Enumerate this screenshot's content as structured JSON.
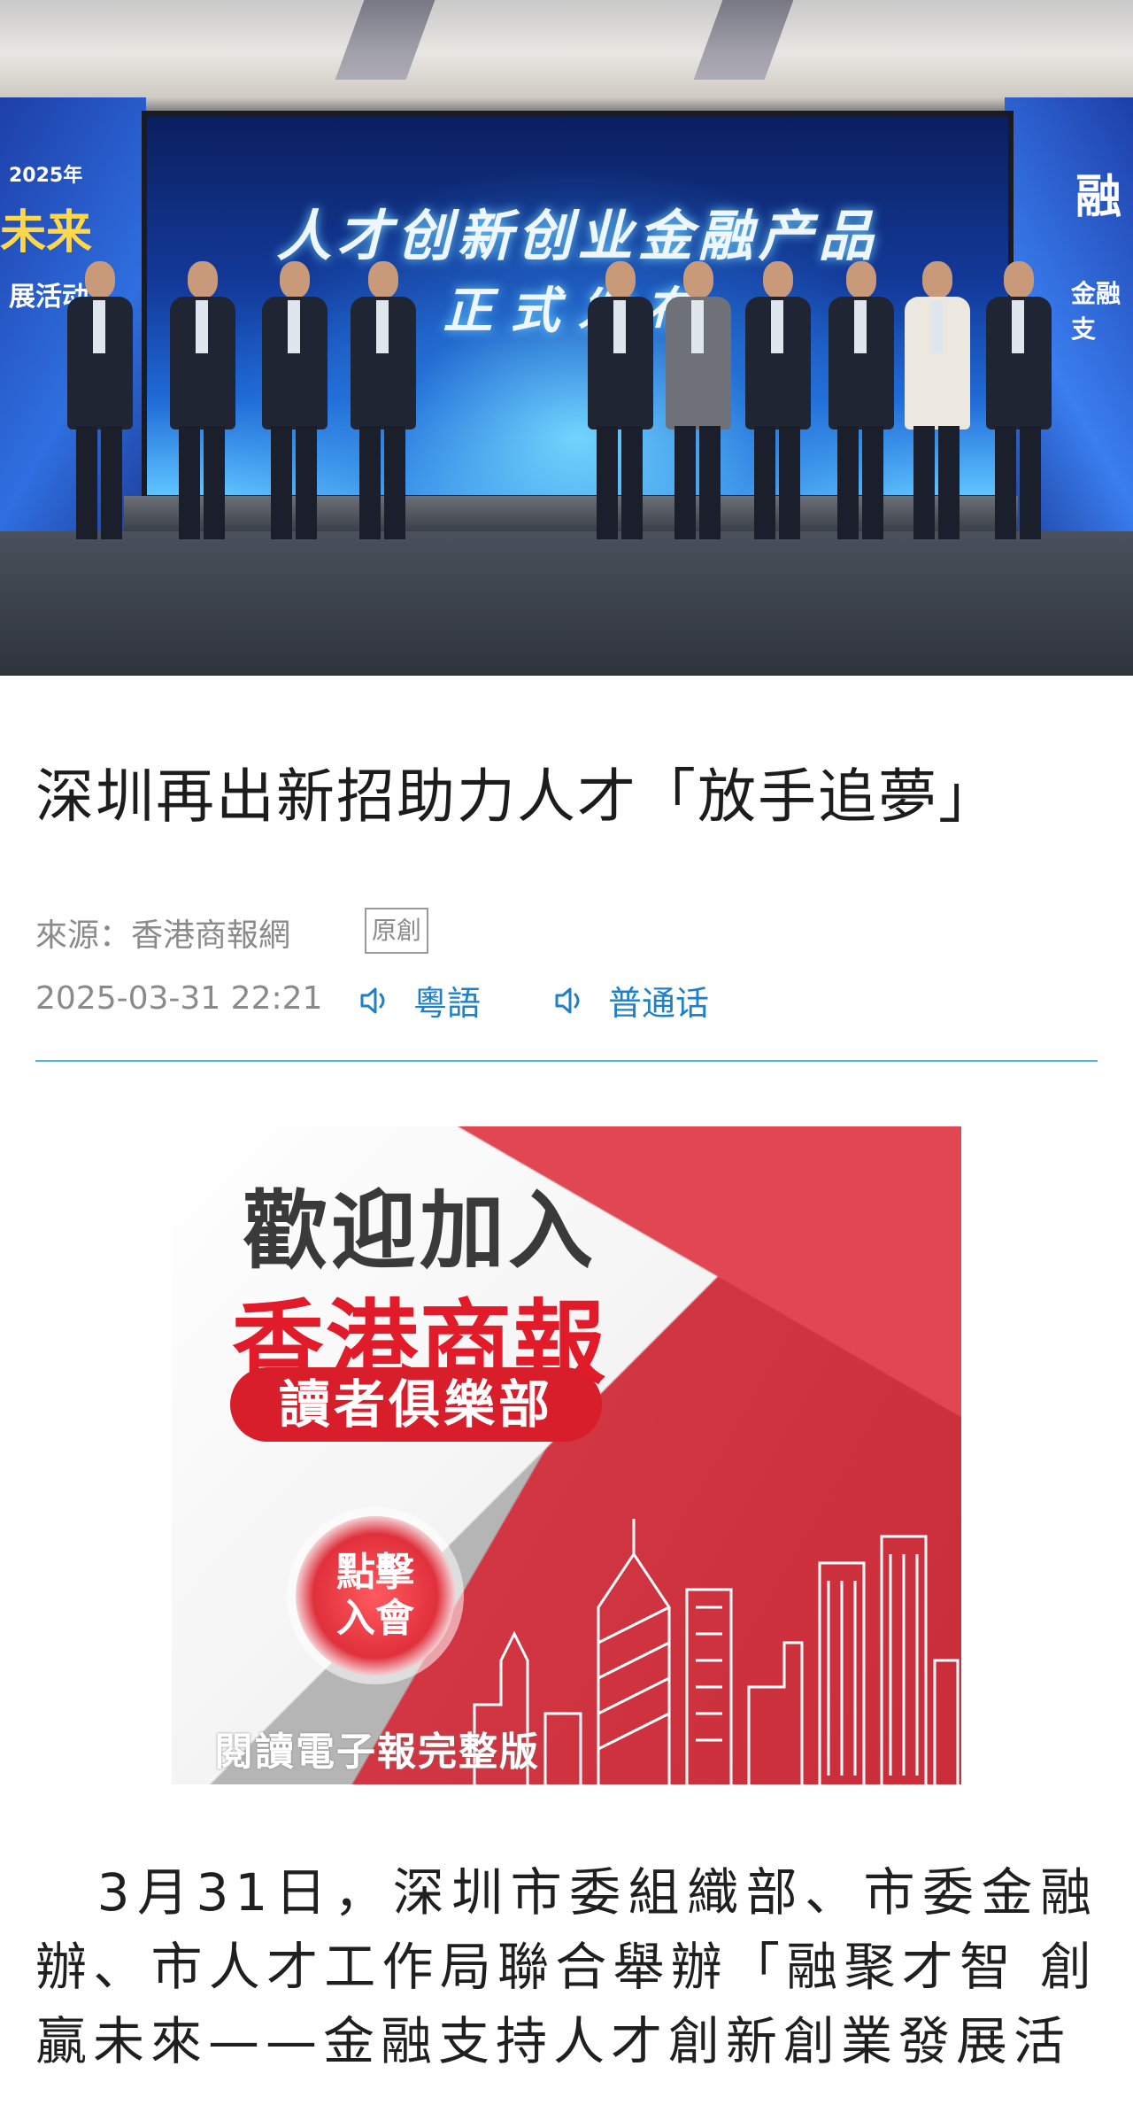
{
  "hero": {
    "screen_line1": "人才创新创业金融产品",
    "screen_line2": "正式发布",
    "left_wall_text": "未来",
    "left_wall_small": "2025年",
    "left_wall_sub": "展活动",
    "right_wall_text": "融",
    "right_wall_sub": "金融支"
  },
  "article": {
    "title": "深圳再出新招助力人才「放手追夢」",
    "source": "來源：香港商報網",
    "badge": "原創",
    "datetime": "2025-03-31 22:21",
    "audio_cantonese": "粵語",
    "audio_mandarin": "普通话",
    "body": "3月31日，深圳市委組織部、市委金融辦、市人才工作局聯合舉辦「融聚才智 創贏未來——金融支持人才創新創業發展活"
  },
  "banner": {
    "welcome": "歡迎加入",
    "brand": "香港商報",
    "club": "讀者俱樂部",
    "join_line1": "點擊",
    "join_line2": "入會",
    "ebook": "閱讀電子報完整版"
  },
  "colors": {
    "accent_blue": "#1f7fc8",
    "divider": "#52b6de",
    "brand_red": "#e11b2a"
  },
  "icons": {
    "audio": "speaker-icon"
  }
}
